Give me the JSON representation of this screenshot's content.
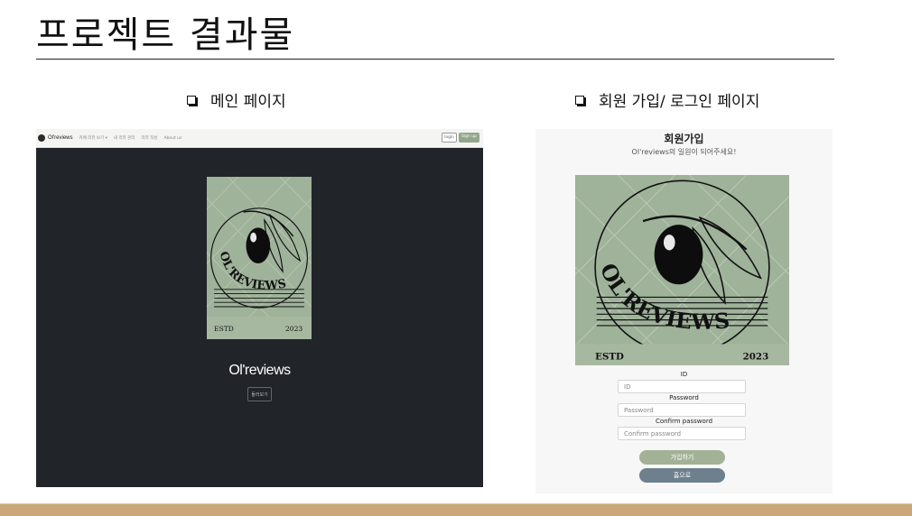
{
  "slide": {
    "title": "프로젝트 결과물",
    "sections": {
      "main": "메인 페이지",
      "signup": "회원 가입/ 로그인 페이지"
    }
  },
  "main_page": {
    "brand": "Ol'reviews",
    "nav_links": [
      "카페 리뷰 보기 ▾",
      "내 리뷰 관리",
      "리뷰 작성",
      "About us"
    ],
    "login_button": "login",
    "signup_button": "Sign up",
    "hero_title": "Ol'reviews",
    "hero_button": "둘러보기"
  },
  "logo": {
    "wordmark": "OL'REVIEWS",
    "estd": "ESTD",
    "year": "2023"
  },
  "signup_page": {
    "title": "회원가입",
    "subtitle": "Ol'reviews의 일원이 되어주세요!",
    "id_label": "ID",
    "id_placeholder": "ID",
    "password_label": "Password",
    "password_placeholder": "Password",
    "confirm_label": "Confirm password",
    "confirm_placeholder": "Confirm password",
    "join_button": "가입하기",
    "home_button": "홈으로"
  },
  "colors": {
    "main_bg": "#212529",
    "logo_bg": "#9fb29a",
    "join_button": "#a3b296",
    "home_button": "#6e7f8e",
    "footer": "#c9a77a"
  }
}
